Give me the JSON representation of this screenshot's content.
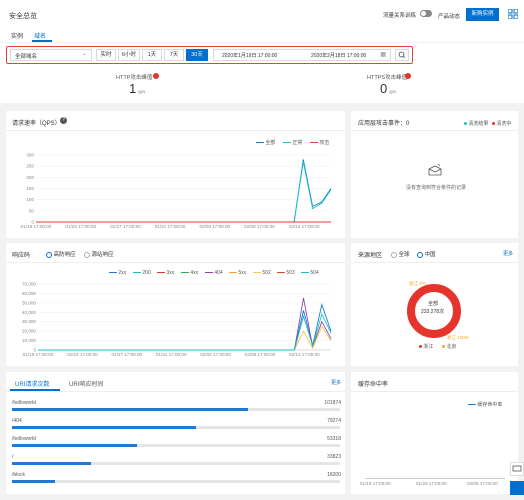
{
  "header": {
    "title": "安全总览",
    "traffic_toggle_label": "流量关系训练",
    "product_label": "产品动态",
    "new_instance_label": "新购实例",
    "tabs": [
      "实例",
      "域名"
    ],
    "active_tab": "域名"
  },
  "filters": {
    "domain_select": "全部域名",
    "ranges": [
      "实时",
      "6小时",
      "1天",
      "7天",
      "30天"
    ],
    "active_range": "30天",
    "start_date": "2020年1月19日 17:00:00",
    "end_date": "2020年2月18日 17:00:00"
  },
  "attack_peaks": {
    "http_label": "HTTP攻击峰值",
    "http_value": "1",
    "https_label": "HTTPS攻击峰值",
    "https_value": "0",
    "unit": "qps"
  },
  "qps_chart": {
    "title": "请求速率（QPS）",
    "legend": [
      "全部",
      "正常",
      "攻击"
    ],
    "y_ticks": [
      "300",
      "250",
      "200",
      "150",
      "100",
      "50",
      "0"
    ],
    "x_ticks": [
      "01/19 17:00:00",
      "01/23 17:00:00",
      "01/27 17:00:00",
      "01/31 17:00:00",
      "02/04 17:00:00",
      "02/08 17:00:00",
      "02/12 17:00:00"
    ]
  },
  "attack_events": {
    "title": "应用层攻击事件：0",
    "legend": [
      "清洗结果",
      "清洗中"
    ],
    "empty_text": "没有查询到符合条件的记录"
  },
  "status_chart": {
    "title": "响应码",
    "radio_options": [
      "高防响应",
      "源站响应"
    ],
    "legend": [
      "2xx",
      "200",
      "3xx",
      "4xx",
      "404",
      "5xx",
      "502",
      "503",
      "504"
    ],
    "y_ticks": [
      "70,000",
      "60,000",
      "50,000",
      "40,000",
      "30,000",
      "20,000",
      "10,000",
      "0"
    ],
    "x_ticks": [
      "01/19 17:00:00",
      "01/23 17:00:00",
      "01/27 17:00:00",
      "01/31 17:00:00",
      "02/04 17:00:00",
      "02/08 17:00:00",
      "02/12 17:00:00"
    ]
  },
  "source_region": {
    "title": "来源地区",
    "options": [
      "全球",
      "中国"
    ],
    "more": "更多",
    "total_label": "全部",
    "total_value": "233,278次",
    "top_label": "浙江 0%",
    "bottom_label": "浙江 100%",
    "legend": [
      "浙江",
      "北京"
    ]
  },
  "uri_panel": {
    "tabs": [
      "URI请求次数",
      "URI响应时间"
    ],
    "more": "更多",
    "rows": [
      {
        "path": "/helloworld",
        "value": "101874",
        "fraction": 0.72
      },
      {
        "path": "/404",
        "value": "79274",
        "fraction": 0.56
      },
      {
        "path": "/helloworld",
        "value": "53318",
        "fraction": 0.38
      },
      {
        "path": "/",
        "value": "33823",
        "fraction": 0.24
      },
      {
        "path": "/block",
        "value": "18200",
        "fraction": 0.13
      }
    ]
  },
  "cache_panel": {
    "title": "缓存命中率",
    "legend": [
      "缓存命中率"
    ],
    "x_ticks": [
      "01/19 17:00:00",
      "01/29 17:00:00",
      "02/08 17:00:00"
    ]
  },
  "colors": {
    "accent": "#0070cc",
    "red": "#e5342b",
    "cyan": "#16c1c4",
    "green": "#3aa55c",
    "orange": "#f5a623",
    "purple": "#8e44ad"
  },
  "chart_data": [
    {
      "type": "line",
      "ylim": [
        0,
        300
      ],
      "series": [
        {
          "name": "全部",
          "values": [
            0,
            0,
            0,
            0,
            0,
            0,
            0,
            0,
            0,
            0,
            0,
            0,
            0,
            0,
            0,
            0,
            0,
            0,
            0,
            0,
            0,
            0,
            0,
            0,
            0,
            0,
            0,
            0,
            0,
            280,
            70,
            90,
            150
          ]
        },
        {
          "name": "正常",
          "values": [
            0,
            0,
            0,
            0,
            0,
            0,
            0,
            0,
            0,
            0,
            0,
            0,
            0,
            0,
            0,
            0,
            0,
            0,
            0,
            0,
            0,
            0,
            0,
            0,
            0,
            0,
            0,
            0,
            0,
            270,
            60,
            85,
            145
          ]
        },
        {
          "name": "攻击",
          "values": [
            0,
            0,
            0,
            0,
            0,
            0,
            0,
            0,
            0,
            0,
            0,
            0,
            0,
            0,
            0,
            0,
            0,
            0,
            0,
            0,
            0,
            0,
            0,
            0,
            0,
            0,
            0,
            0,
            0,
            0,
            0,
            0,
            0
          ]
        }
      ]
    },
    {
      "type": "line",
      "ylim": [
        0,
        70000
      ],
      "series": [
        {
          "name": "2xx",
          "values": [
            0,
            0,
            0,
            0,
            0,
            0,
            0,
            0,
            0,
            0,
            0,
            0,
            0,
            0,
            0,
            0,
            0,
            0,
            0,
            0,
            0,
            0,
            0,
            0,
            0,
            0,
            0,
            0,
            0,
            42000,
            5000,
            48000,
            20000
          ]
        },
        {
          "name": "404",
          "values": [
            0,
            0,
            0,
            0,
            0,
            0,
            0,
            0,
            0,
            0,
            0,
            0,
            0,
            0,
            0,
            0,
            0,
            0,
            0,
            0,
            0,
            0,
            0,
            0,
            0,
            0,
            0,
            0,
            0,
            55000,
            3000,
            30000,
            12000
          ]
        },
        {
          "name": "502",
          "values": [
            0,
            0,
            0,
            0,
            0,
            0,
            0,
            0,
            0,
            0,
            0,
            0,
            0,
            0,
            0,
            0,
            0,
            0,
            0,
            0,
            0,
            0,
            0,
            0,
            0,
            0,
            0,
            0,
            0,
            20000,
            2000,
            25000,
            10000
          ]
        },
        {
          "name": "200",
          "values": [
            0,
            0,
            0,
            0,
            0,
            0,
            0,
            0,
            0,
            0,
            0,
            0,
            0,
            0,
            0,
            0,
            0,
            0,
            0,
            0,
            0,
            0,
            0,
            0,
            0,
            0,
            0,
            0,
            0,
            36000,
            4000,
            38000,
            18000
          ]
        }
      ]
    }
  ]
}
